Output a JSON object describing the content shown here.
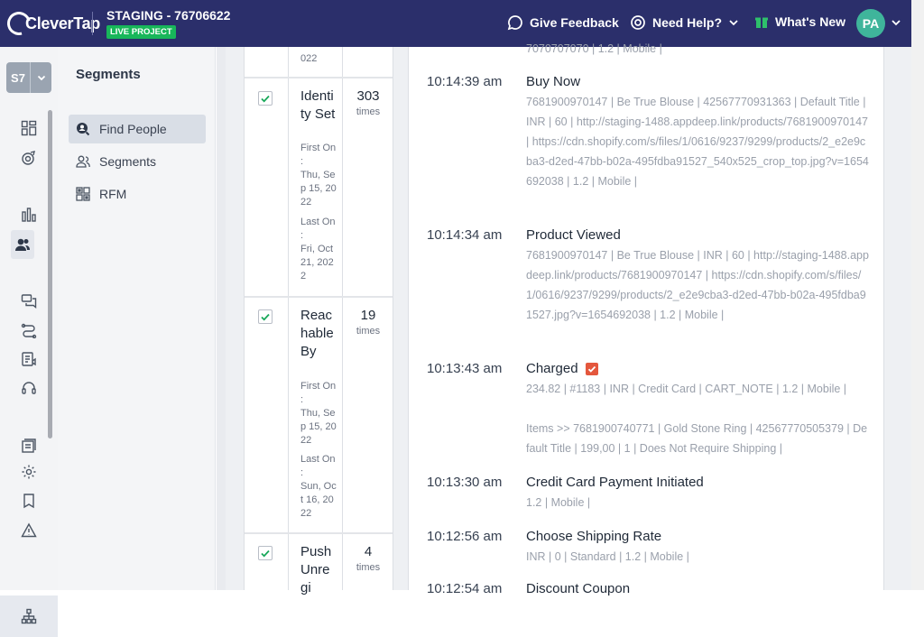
{
  "app": {
    "logo_text": "CleverTap",
    "project_name": "STAGING - 76706622",
    "project_badge": "LIVE PROJECT"
  },
  "topnav": {
    "feedback": "Give Feedback",
    "help": "Need Help?",
    "whats_new": "What's New",
    "avatar_initials": "PA"
  },
  "account": {
    "initials": "S7"
  },
  "sidebar": {
    "title": "Segments",
    "items": [
      {
        "label": "Find People",
        "icon": "find-people-icon",
        "active": true
      },
      {
        "label": "Segments",
        "icon": "segments-icon",
        "active": false
      },
      {
        "label": "RFM",
        "icon": "rfm-icon",
        "active": false
      }
    ]
  },
  "events_table": {
    "top_partial": "022",
    "rows": [
      {
        "name": "Identity Set",
        "count": "303",
        "count_unit": "times",
        "first_label": "First On :",
        "first_value": "Thu, Sep 15, 2022",
        "last_label": "Last On :",
        "last_value": "Fri, Oct 21, 2022",
        "checked": true
      },
      {
        "name": "Reachable By",
        "count": "19",
        "count_unit": "times",
        "first_label": "First On :",
        "first_value": "Thu, Sep 15, 2022",
        "last_label": "Last On :",
        "last_value": "Sun, Oct 16, 2022",
        "checked": true
      },
      {
        "name": "Push Unregi",
        "count": "4",
        "count_unit": "times",
        "checked": true
      }
    ]
  },
  "timeline": {
    "top_partial": "7070707070 | 1.2 | Mobile |",
    "events": [
      {
        "time": "10:14:39 am",
        "name": "Buy Now",
        "props": "7681900970147 | Be True Blouse | 42567770931363 | Default Title | INR | 60 | http://staging-1488.appdeep.link/products/7681900970147 | https://cdn.shopify.com/s/files/1/0616/9237/9299/products/2_e2e9cba3-d2ed-47bb-b02a-495fdba91527_540x525_crop_top.jpg?v=1654692038 | 1.2 | Mobile |"
      },
      {
        "time": "10:14:34 am",
        "name": "Product Viewed",
        "props": "7681900970147 | Be True Blouse | INR | 60 | http://staging-1488.appdeep.link/products/7681900970147 | https://cdn.shopify.com/s/files/1/0616/9237/9299/products/2_e2e9cba3-d2ed-47bb-b02a-495fdba91527.jpg?v=1654692038 | 1.2 | Mobile |"
      },
      {
        "time": "10:13:43 am",
        "name": "Charged",
        "props": "234.82 | #1183 | INR | Credit Card | CART_NOTE | 1.2 | Mobile |",
        "props2": "Items >> 7681900740771 | Gold Stone Ring | 42567770505379 | Default Title | 199,00 | 1 | Does Not Require Shipping |"
      },
      {
        "time": "10:13:30 am",
        "name": "Credit Card Payment Initiated",
        "props": "1.2 | Mobile |"
      },
      {
        "time": "10:12:56 am",
        "name": "Choose Shipping Rate",
        "props": "INR | 0 | Standard | 1.2 | Mobile |"
      },
      {
        "time": "10:12:54 am",
        "name": "Discount Coupon"
      }
    ]
  },
  "colors": {
    "topbar": "#2b2f6b",
    "live": "#18b65a",
    "avatar": "#3fb59b",
    "check": "#18a85a",
    "charged_badge": "#e4573d"
  }
}
